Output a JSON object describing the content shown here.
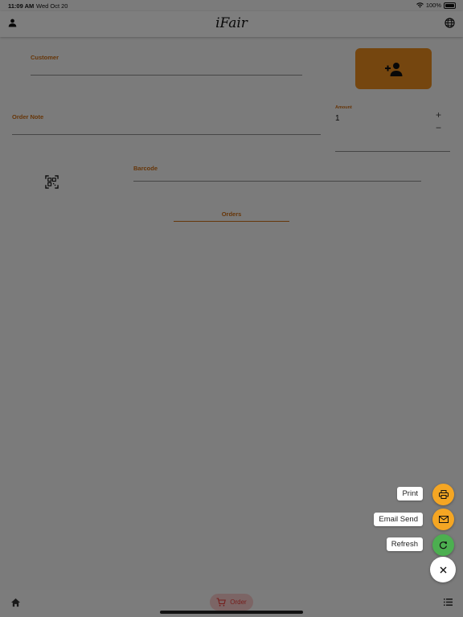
{
  "status": {
    "time": "11:09 AM",
    "date": "Wed Oct 20",
    "battery": "100%"
  },
  "appbar": {
    "title": "iFair",
    "icons": [
      "person-icon",
      "globe-icon"
    ]
  },
  "form": {
    "customer_label": "Customer",
    "order_note_label": "Order Note",
    "amount_label": "Amount",
    "amount_value": "1",
    "plus": "+",
    "minus": "−",
    "barcode_label": "Barcode",
    "orders_label": "Orders"
  },
  "fab": {
    "actions": [
      {
        "label": "Print",
        "icon": "printer-icon",
        "color": "#f5a623"
      },
      {
        "label": "Email Send",
        "icon": "mail-icon",
        "color": "#f5a623"
      },
      {
        "label": "Refresh",
        "icon": "refresh-icon",
        "color": "#4caf50"
      }
    ],
    "main_icon": "close-icon"
  },
  "bottom_nav": {
    "order_label": "Order",
    "icons": [
      "home-icon",
      "cart-icon",
      "list-icon"
    ]
  },
  "colors": {
    "accent": "#e58a1f",
    "label": "#c96a12",
    "nav_active": "#e53935"
  }
}
